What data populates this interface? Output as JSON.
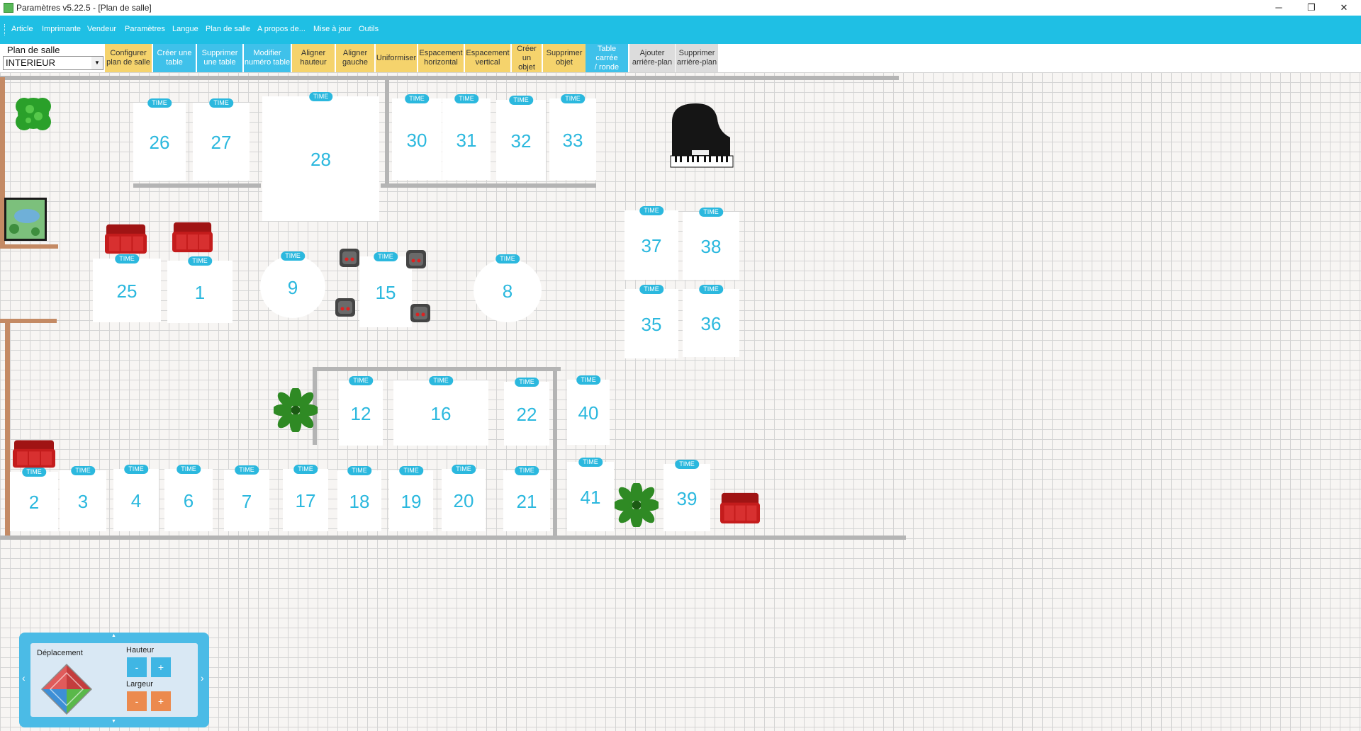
{
  "window": {
    "title": "Paramètres v5.22.5 - [Plan de salle]",
    "min": "─",
    "max": "❐",
    "close": "✕"
  },
  "menu": [
    "Article",
    "Imprimante",
    "Vendeur",
    "Paramètres",
    "Langue",
    "Plan de salle",
    "A propos de...",
    "Mise à jour",
    "Outils"
  ],
  "toolbar": {
    "plan_label": "Plan de salle",
    "plan_value": "INTERIEUR",
    "buttons": [
      {
        "label": "Configurer\nplan de salle",
        "color": "yellow"
      },
      {
        "label": "Créer une\ntable",
        "color": "blue"
      },
      {
        "label": "Supprimer\nune table",
        "color": "blue"
      },
      {
        "label": "Modifier\nnuméro table",
        "color": "blue"
      },
      {
        "label": "Aligner\nhauteur",
        "color": "yellow"
      },
      {
        "label": "Aligner\ngauche",
        "color": "yellow"
      },
      {
        "label": "Uniformiser",
        "color": "yellow"
      },
      {
        "label": "Espacement\nhorizontal",
        "color": "yellow"
      },
      {
        "label": "Espacement\nvertical",
        "color": "yellow"
      },
      {
        "label": "Créer un\nobjet",
        "color": "yellow"
      },
      {
        "label": "Supprimer\nobjet",
        "color": "yellow"
      },
      {
        "label": "Table carrée\n/ ronde",
        "color": "blue"
      },
      {
        "label": "Ajouter\narrière-plan",
        "color": "gray"
      },
      {
        "label": "Supprimer\narrière-plan",
        "color": "gray"
      }
    ]
  },
  "table_tag": "TIME",
  "tables": [
    "26",
    "27",
    "28",
    "30",
    "31",
    "32",
    "33",
    "25",
    "1",
    "9",
    "15",
    "8",
    "37",
    "38",
    "35",
    "36",
    "12",
    "16",
    "22",
    "40",
    "2",
    "3",
    "4",
    "6",
    "7",
    "17",
    "18",
    "19",
    "20",
    "21",
    "41",
    "39"
  ],
  "panel": {
    "move_label": "Déplacement",
    "height_label": "Hauteur",
    "width_label": "Largeur",
    "minus": "-",
    "plus": "+",
    "left": "‹",
    "right": "›",
    "up": "▲",
    "down": "▼"
  },
  "colors": {
    "accent": "#1fbfe4",
    "table_text": "#2bb8de",
    "wall_gray": "#b4b4b4",
    "wall_brown": "#c48a64",
    "sofa_red": "#c41c1c",
    "button_yellow": "#f5d36c",
    "button_orange": "#ec8a4e"
  }
}
